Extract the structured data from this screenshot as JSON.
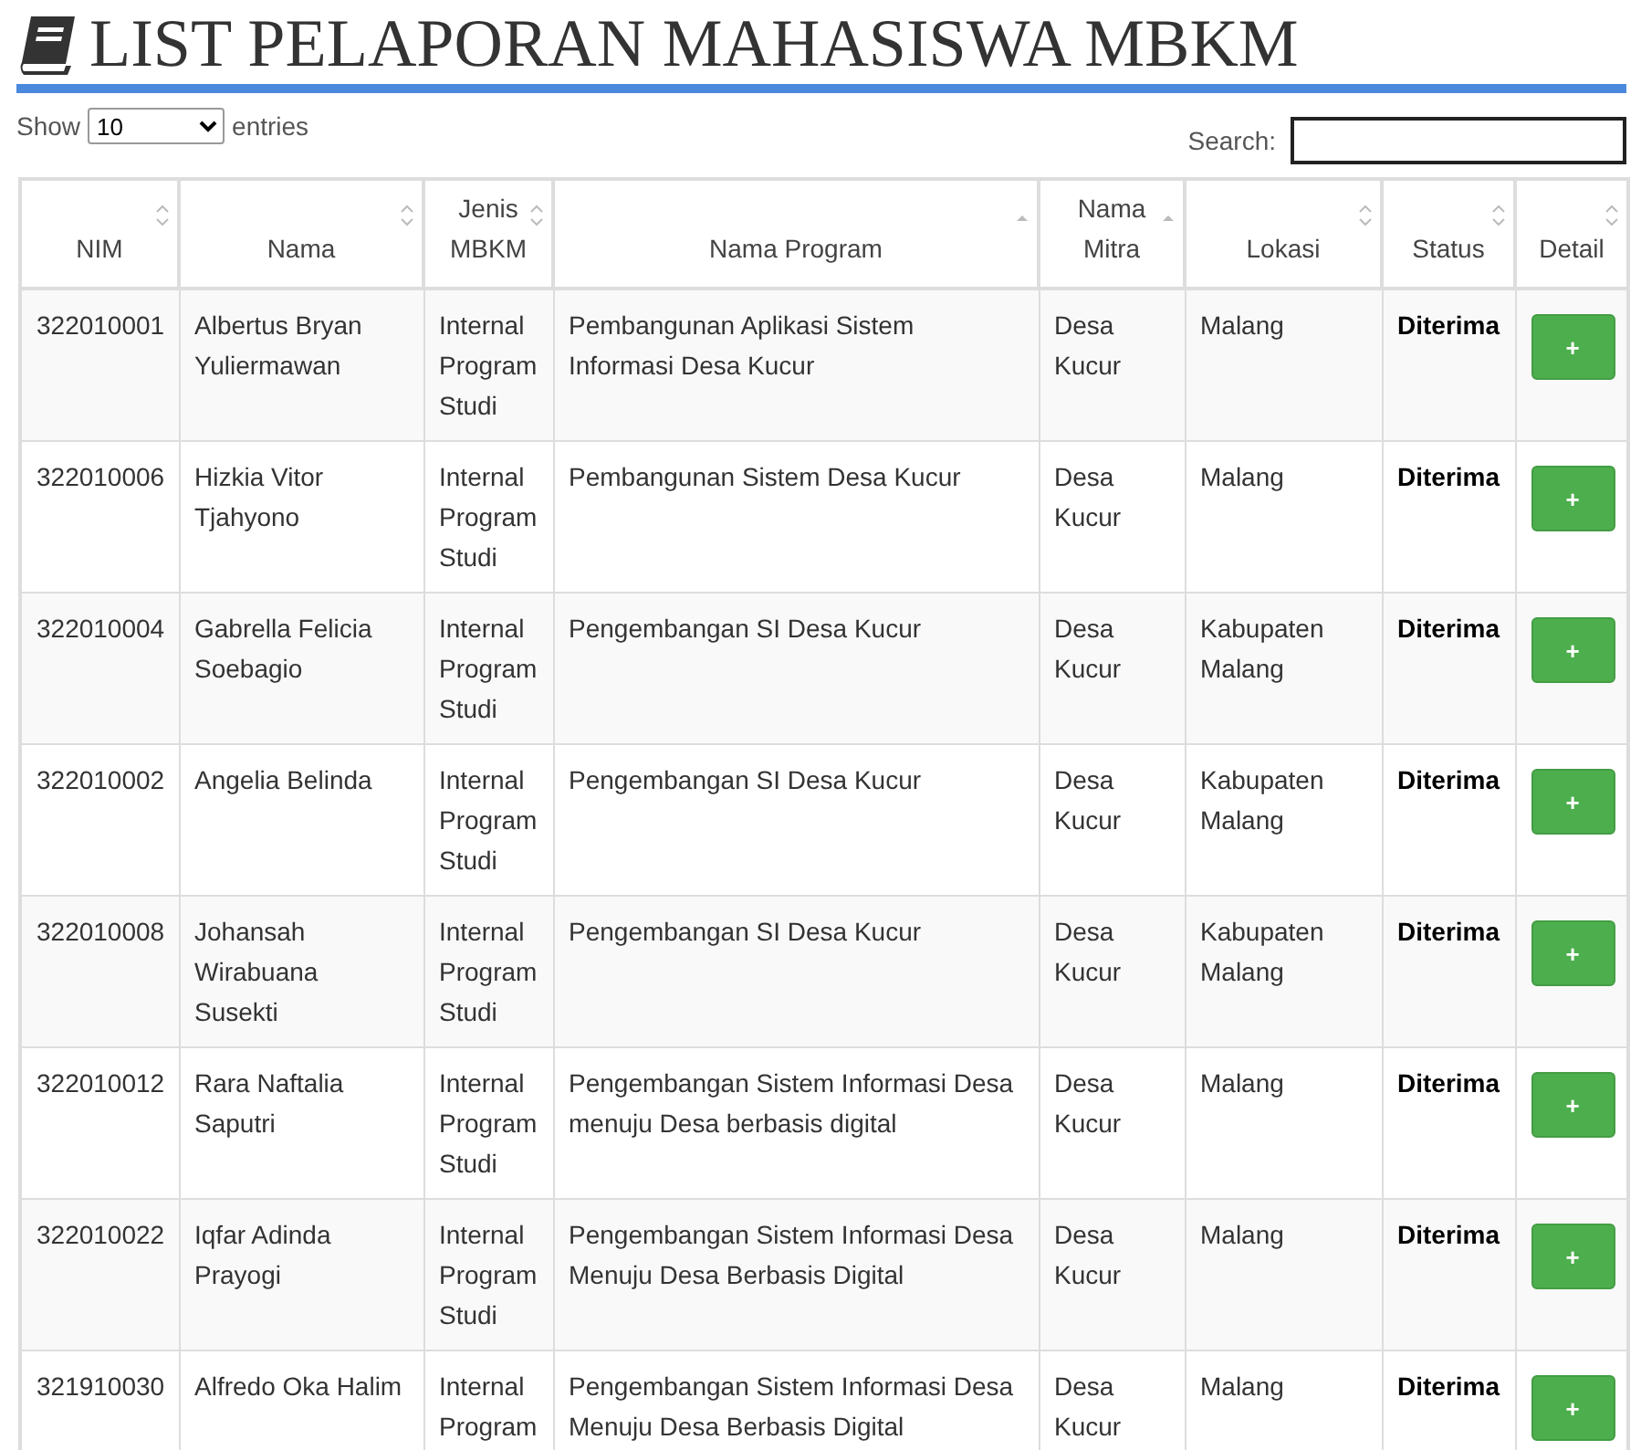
{
  "title": "LIST PELAPORAN MAHASISWA MBKM",
  "length_control": {
    "before": "Show",
    "value": "10",
    "after": "entries"
  },
  "search": {
    "label": "Search:"
  },
  "table": {
    "columns": [
      {
        "label": "NIM",
        "sorted_ascending": false
      },
      {
        "label": "Nama",
        "sorted_ascending": false
      },
      {
        "label": "Jenis MBKM",
        "sorted_ascending": false
      },
      {
        "label": "Nama Program",
        "sorted_ascending": true
      },
      {
        "label": "Nama Mitra",
        "sorted_ascending": true
      },
      {
        "label": "Lokasi",
        "sorted_ascending": false
      },
      {
        "label": "Status",
        "sorted_ascending": false
      },
      {
        "label": "Detail",
        "sorted_ascending": false
      }
    ],
    "rows": [
      {
        "nim": "322010001",
        "nama": "Albertus Bryan Yuliermawan",
        "jenis": "Internal Program Studi",
        "program": "Pembangunan Aplikasi Sistem Informasi Desa Kucur",
        "mitra": "Desa Kucur",
        "lokasi": "Malang",
        "status": "Diterima",
        "detail": "+"
      },
      {
        "nim": "322010006",
        "nama": "Hizkia Vitor Tjahyono",
        "jenis": "Internal Program Studi",
        "program": "Pembangunan Sistem Desa Kucur",
        "mitra": "Desa Kucur",
        "lokasi": "Malang",
        "status": "Diterima",
        "detail": "+"
      },
      {
        "nim": "322010004",
        "nama": "Gabrella Felicia Soebagio",
        "jenis": "Internal Program Studi",
        "program": "Pengembangan SI Desa Kucur",
        "mitra": "Desa Kucur",
        "lokasi": "Kabupaten Malang",
        "status": "Diterima",
        "detail": "+"
      },
      {
        "nim": "322010002",
        "nama": "Angelia Belinda",
        "jenis": "Internal Program Studi",
        "program": "Pengembangan SI Desa Kucur",
        "mitra": "Desa Kucur",
        "lokasi": "Kabupaten Malang",
        "status": "Diterima",
        "detail": "+"
      },
      {
        "nim": "322010008",
        "nama": "Johansah Wirabuana Susekti",
        "jenis": "Internal Program Studi",
        "program": "Pengembangan SI Desa Kucur",
        "mitra": "Desa Kucur",
        "lokasi": "Kabupaten Malang",
        "status": "Diterima",
        "detail": "+"
      },
      {
        "nim": "322010012",
        "nama": "Rara Naftalia Saputri",
        "jenis": "Internal Program Studi",
        "program": "Pengembangan Sistem Informasi Desa menuju Desa berbasis digital",
        "mitra": "Desa Kucur",
        "lokasi": "Malang",
        "status": "Diterima",
        "detail": "+"
      },
      {
        "nim": "322010022",
        "nama": "Iqfar Adinda Prayogi",
        "jenis": "Internal Program Studi",
        "program": "Pengembangan Sistem Informasi Desa Menuju Desa Berbasis Digital",
        "mitra": "Desa Kucur",
        "lokasi": "Malang",
        "status": "Diterima",
        "detail": "+"
      },
      {
        "nim": "321910030",
        "nama": "Alfredo Oka Halim",
        "jenis": "Internal Program",
        "program": "Pengembangan Sistem Informasi Desa Menuju Desa Berbasis Digital",
        "mitra": "Desa Kucur",
        "lokasi": "Malang",
        "status": "Diterima",
        "detail": "+"
      }
    ]
  }
}
